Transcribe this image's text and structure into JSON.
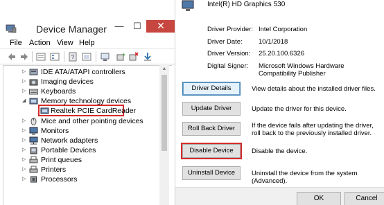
{
  "device_manager": {
    "title": "Device Manager",
    "controls": {
      "minimize": "—",
      "maximize": "☐",
      "close": "✕"
    },
    "menu": [
      "File",
      "Action",
      "View",
      "Help"
    ],
    "tree": [
      {
        "label": "IDE ATA/ATAPI controllers",
        "expander": "▷",
        "icon": "ide-controller-icon"
      },
      {
        "label": "Imaging devices",
        "expander": "▷",
        "icon": "camera-icon"
      },
      {
        "label": "Keyboards",
        "expander": "▷",
        "icon": "keyboard-icon"
      },
      {
        "label": "Memory technology devices",
        "expander": "◢",
        "icon": "memory-device-icon"
      },
      {
        "label": "Realtek PCIE CardReader",
        "expander": "",
        "icon": "card-reader-icon",
        "selected": true
      },
      {
        "label": "Mice and other pointing devices",
        "expander": "▷",
        "icon": "mouse-icon"
      },
      {
        "label": "Monitors",
        "expander": "▷",
        "icon": "monitor-icon"
      },
      {
        "label": "Network adapters",
        "expander": "▷",
        "icon": "network-adapter-icon"
      },
      {
        "label": "Portable Devices",
        "expander": "▷",
        "icon": "portable-device-icon"
      },
      {
        "label": "Print queues",
        "expander": "▷",
        "icon": "printer-icon"
      },
      {
        "label": "Printers",
        "expander": "▷",
        "icon": "printer-icon"
      },
      {
        "label": "Processors",
        "expander": "▷",
        "icon": "processor-icon"
      }
    ]
  },
  "properties": {
    "device_name": "Intel(R) HD Graphics 530",
    "info": [
      {
        "label": "Driver Provider:",
        "value": "Intel Corporation"
      },
      {
        "label": "Driver Date:",
        "value": "10/1/2018"
      },
      {
        "label": "Driver Version:",
        "value": "25.20.100.6326"
      },
      {
        "label": "Digital Signer:",
        "value": "Microsoft Windows Hardware Compatibility Publisher"
      }
    ],
    "actions": [
      {
        "button": "Driver Details",
        "description": "View details about the installed driver files."
      },
      {
        "button": "Update Driver",
        "description": "Update the driver for this device."
      },
      {
        "button": "Roll Back Driver",
        "description": "If the device fails after updating the driver, roll back to the previously installed driver."
      },
      {
        "button": "Disable Device",
        "description": "Disable the device."
      },
      {
        "button": "Uninstall Device",
        "description": "Uninstall the device from the system (Advanced)."
      }
    ],
    "footer": {
      "ok": "OK",
      "cancel": "Cancel"
    }
  },
  "colors": {
    "close_button": "#c7463f",
    "highlight_red": "#d62b2b",
    "focus_blue": "#3c7fb1",
    "selection_text": "#000000"
  }
}
